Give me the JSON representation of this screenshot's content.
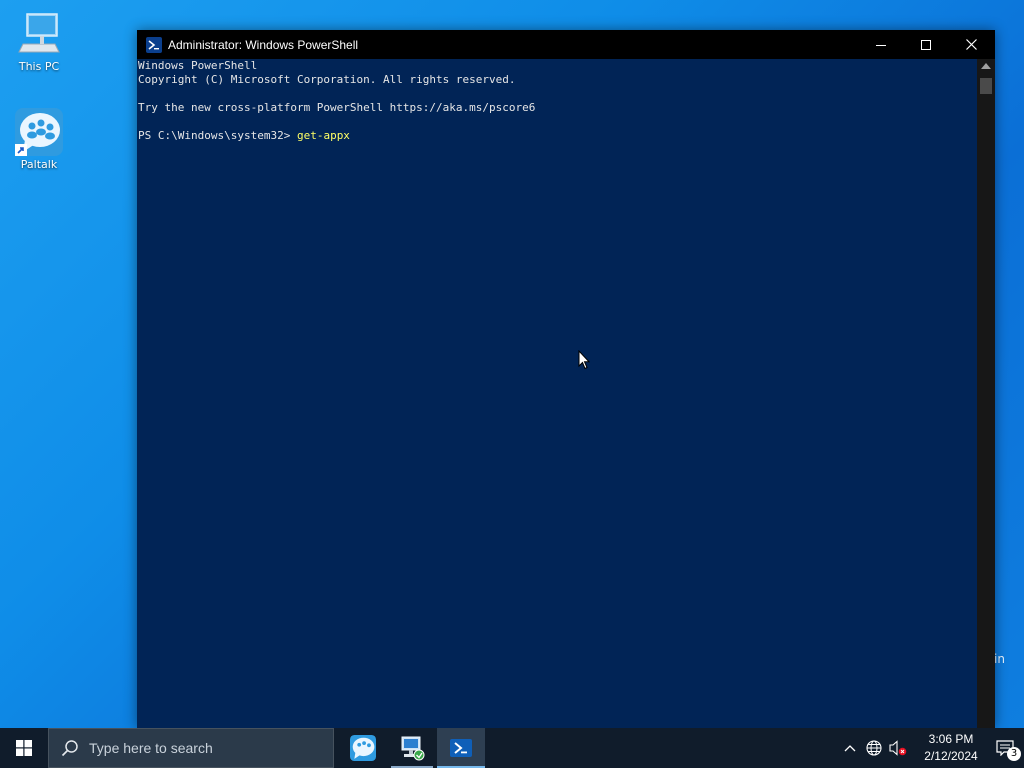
{
  "desktop": {
    "icons": [
      {
        "label": "This PC",
        "icon": "computer-icon"
      },
      {
        "label": "Paltalk",
        "icon": "paltalk-icon"
      }
    ],
    "watermark_text": "in"
  },
  "window": {
    "title": "Administrator: Windows PowerShell",
    "buttons": {
      "minimize": "minimize-icon",
      "maximize": "maximize-icon",
      "close": "close-icon"
    },
    "console": {
      "lines": [
        "Windows PowerShell",
        "Copyright (C) Microsoft Corporation. All rights reserved.",
        "",
        "Try the new cross-platform PowerShell https://aka.ms/pscore6",
        ""
      ],
      "prompt": "PS C:\\Windows\\system32> ",
      "command": "get-appx"
    }
  },
  "taskbar": {
    "search_placeholder": "Type here to search",
    "apps": [
      {
        "name": "paltalk",
        "icon": "paltalk-icon"
      },
      {
        "name": "network-admin",
        "icon": "network-computer-icon"
      },
      {
        "name": "powershell",
        "icon": "powershell-icon",
        "active": true
      }
    ],
    "tray": {
      "time": "3:06 PM",
      "date": "2/12/2024",
      "notification_count": "3"
    }
  },
  "colors": {
    "console_bg": "#012456",
    "command_text": "#ffff66",
    "taskbar_bg": "#101c2b"
  }
}
